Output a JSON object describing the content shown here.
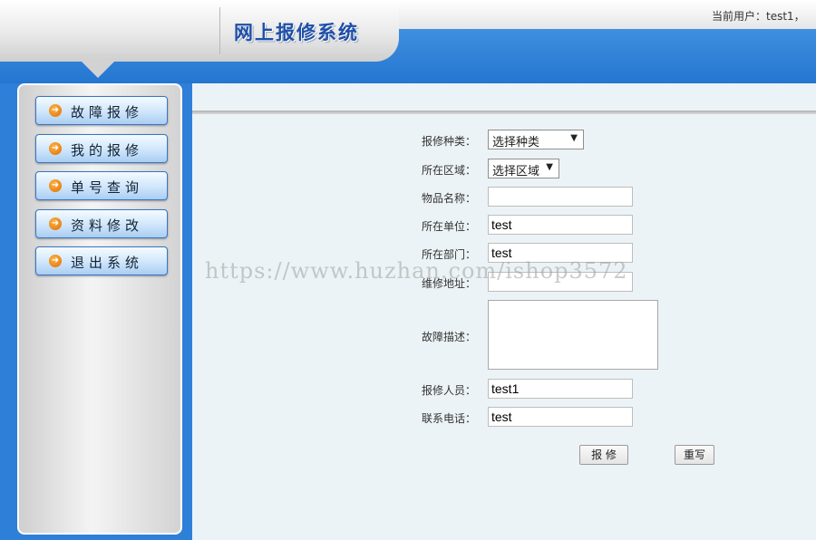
{
  "header": {
    "brand": "网上报修系统",
    "user_info": "当前用户：test1，",
    "colors": {
      "brand_blue": "#1f4fa8",
      "header_blue": "#2e7fd8"
    }
  },
  "nav": {
    "items": [
      {
        "label": "故障报修",
        "icon": "orange-arrow-icon"
      },
      {
        "label": "我的报修",
        "icon": "orange-arrow-icon"
      },
      {
        "label": "单号查询",
        "icon": "orange-arrow-icon"
      },
      {
        "label": "资料修改",
        "icon": "orange-arrow-icon"
      },
      {
        "label": "退出系统",
        "icon": "orange-arrow-icon"
      }
    ]
  },
  "form": {
    "category": {
      "label": "报修种类：",
      "value": "选择种类"
    },
    "area": {
      "label": "所在区域：",
      "value": "选择区域"
    },
    "item_name": {
      "label": "物品名称：",
      "value": ""
    },
    "unit": {
      "label": "所在单位：",
      "value": "test"
    },
    "department": {
      "label": "所在部门：",
      "value": "test"
    },
    "address": {
      "label": "维修地址：",
      "value": ""
    },
    "description": {
      "label": "故障描述：",
      "value": ""
    },
    "reporter": {
      "label": "报修人员：",
      "value": "test1"
    },
    "phone": {
      "label": "联系电话：",
      "value": "test"
    },
    "submit_label": "报 修",
    "reset_label": "重写"
  },
  "watermark": "https://www.huzhan.com/ishop3572"
}
